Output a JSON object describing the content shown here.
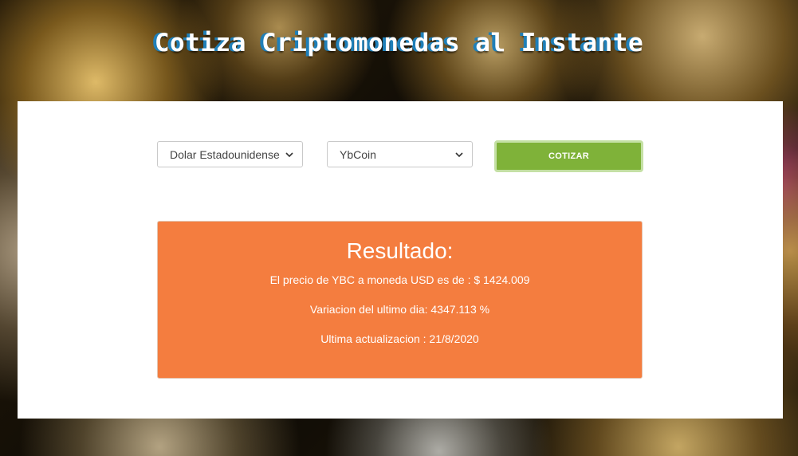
{
  "header": {
    "title": "Cotiza Criptomonedas al Instante"
  },
  "form": {
    "currency_select": {
      "value": "Dolar Estadounidense"
    },
    "crypto_select": {
      "value": "YbCoin"
    },
    "submit_label": "COTIZAR"
  },
  "result": {
    "title": "Resultado:",
    "price_text": "El precio de YBC a moneda USD es de : $ 1424.009",
    "change_text": "Variacion del ultimo dia: 4347.113 %",
    "updated_text": "Ultima actualizacion : 21/8/2020"
  },
  "colors": {
    "button_green": "#7fb239",
    "result_orange": "#f47d3f",
    "title_shadow_blue": "#1f7fb8"
  },
  "icons": {
    "select_arrow": "chevron-down-icon"
  }
}
